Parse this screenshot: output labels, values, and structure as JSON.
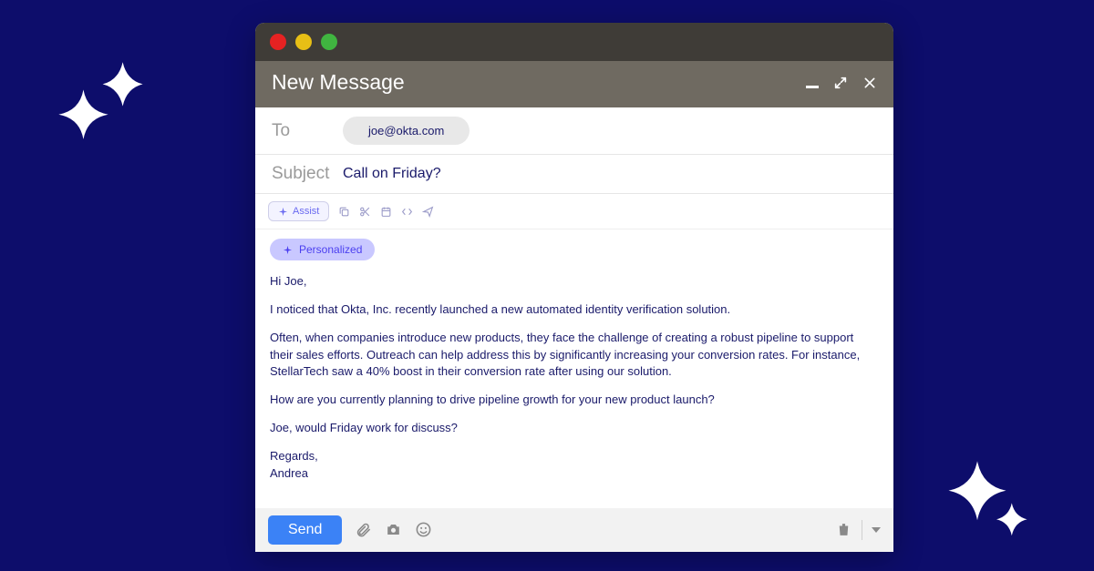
{
  "header": {
    "title": "New Message"
  },
  "fields": {
    "to_label": "To",
    "to_chip": "joe@okta.com",
    "subject_label": "Subject",
    "subject_value": "Call on Friday?"
  },
  "toolbar": {
    "assist_label": "Assist"
  },
  "tag": {
    "personalized_label": "Personalized"
  },
  "body": {
    "p1": "Hi Joe,",
    "p2": "I noticed that Okta, Inc. recently launched a new automated identity verification solution.",
    "p3": "Often, when companies introduce new products, they face the challenge of creating a robust pipeline to support their sales efforts. Outreach can help address this by significantly increasing your conversion rates. For instance, StellarTech saw a 40% boost in their conversion rate after using our solution.",
    "p4": "How are you currently planning to drive pipeline growth for your new product launch?",
    "p5": "Joe, would Friday work for discuss?",
    "p6": "Regards,",
    "p7": "Andrea"
  },
  "footer": {
    "send_label": "Send"
  }
}
